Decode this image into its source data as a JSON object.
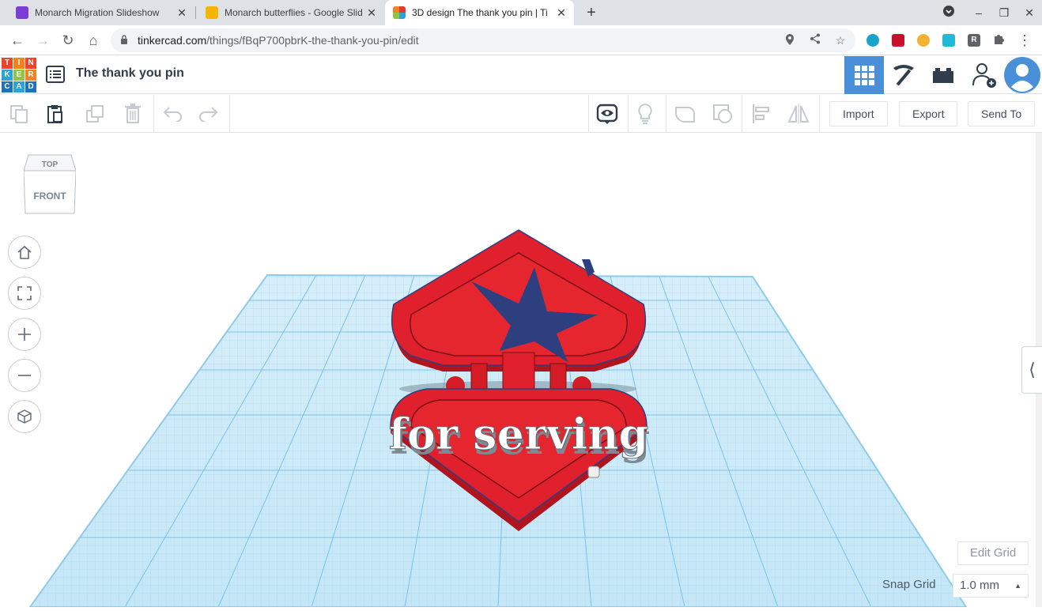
{
  "browser": {
    "tabs": [
      {
        "title": "Monarch Migration Slideshow",
        "favicon_color": "#7b3fd6",
        "active": false
      },
      {
        "title": "Monarch butterflies - Google Slid",
        "favicon_color": "#f4b400",
        "active": false
      },
      {
        "title": "3D design The thank you pin | Ti",
        "favicon_color": "#e23a2e",
        "active": true
      }
    ],
    "url_domain": "tinkercad.com",
    "url_path": "/things/fBqP700pbrK-the-thank-you-pin/edit",
    "extensions": [
      {
        "label": "",
        "color": "#1aa3c8"
      },
      {
        "label": "",
        "color": "#c8102e"
      },
      {
        "label": "",
        "color": "#f2b233"
      },
      {
        "label": "",
        "color": "#1fbad6"
      },
      {
        "label": "R",
        "color": "#5f6368"
      }
    ]
  },
  "app": {
    "logo_letters": [
      "T",
      "I",
      "N",
      "K",
      "E",
      "R",
      "C",
      "A",
      "D"
    ],
    "logo_colors": [
      "#e8472b",
      "#f58220",
      "#e8472b",
      "#2aa3dc",
      "#8dc63f",
      "#f58220",
      "#1e73b8",
      "#2aa3dc",
      "#1e73b8"
    ],
    "design_title": "The thank you pin",
    "accent_color": "#4a90d9"
  },
  "toolbar": {
    "import_label": "Import",
    "export_label": "Export",
    "send_to_label": "Send To"
  },
  "viewcube": {
    "top_label": "TOP",
    "front_label": "FRONT"
  },
  "model": {
    "text": "for serving",
    "primary_color": "#e0202c",
    "star_color": "#2e3f80"
  },
  "grid": {
    "edit_grid_label": "Edit Grid",
    "snap_grid_label": "Snap Grid",
    "snap_grid_value": "1.0 mm"
  }
}
